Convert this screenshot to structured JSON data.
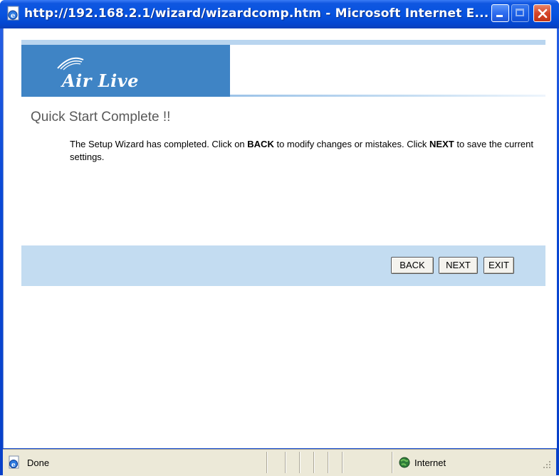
{
  "window": {
    "title": "http://192.168.2.1/wizard/wizardcomp.htm - Microsoft Internet E...",
    "icon": "ie-page-icon",
    "controls": [
      "minimize",
      "maximize",
      "close"
    ]
  },
  "page": {
    "logo_text": "Air Live",
    "heading": "Quick Start Complete !!",
    "message": {
      "part1": "The Setup Wizard has completed. Click on ",
      "bold1": "BACK",
      "part2": " to modify changes or mistakes. Click ",
      "bold2": "NEXT",
      "part3": " to save the current settings."
    },
    "buttons": {
      "back": "BACK",
      "next": "NEXT",
      "exit": "EXIT"
    }
  },
  "statusbar": {
    "status": "Done",
    "zone": "Internet"
  },
  "colors": {
    "titlebar": "#0753e0",
    "banner": "#3f84c5",
    "button_bar": "#c3dcf1",
    "heading": "#595959"
  }
}
